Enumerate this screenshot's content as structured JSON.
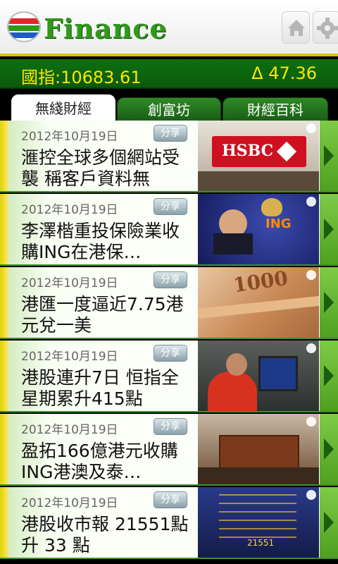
{
  "header": {
    "logo_name": "tvb-logo-icon",
    "title": "Finance",
    "home_icon": "home-icon",
    "settings_icon": "gear-icon"
  },
  "index": {
    "label": "國指:10683.61",
    "change": "Δ  47.36"
  },
  "tabs": [
    {
      "label": "無綫財經",
      "active": true
    },
    {
      "label": "創富坊",
      "active": false
    },
    {
      "label": "財經百科",
      "active": false
    }
  ],
  "news": [
    {
      "date": "2012年10月19日",
      "share": "分享",
      "headline": "滙控全球多個網站受襲 稱客戶資料無",
      "thumb_text": "HSBC"
    },
    {
      "date": "2012年10月19日",
      "share": "分享",
      "headline": "李澤楷重投保險業收購ING在港保…",
      "thumb_text": "ING"
    },
    {
      "date": "2012年10月19日",
      "share": "分享",
      "headline": "港匯一度逼近7.75港元兌一美",
      "thumb_text": "1000"
    },
    {
      "date": "2012年10月19日",
      "share": "分享",
      "headline": "港股連升7日 恒指全星期累升415點",
      "thumb_text": ""
    },
    {
      "date": "2012年10月19日",
      "share": "分享",
      "headline": "盈拓166億港元收購ING港澳及泰…",
      "thumb_text": ""
    },
    {
      "date": "2012年10月19日",
      "share": "分享",
      "headline": "港股收市報 21551點 升 33 點",
      "thumb_text": "21551"
    }
  ],
  "colors": {
    "brand_green": "#2f9a1a",
    "index_yellow": "#ffe600",
    "bar_green": "#0e7010"
  }
}
